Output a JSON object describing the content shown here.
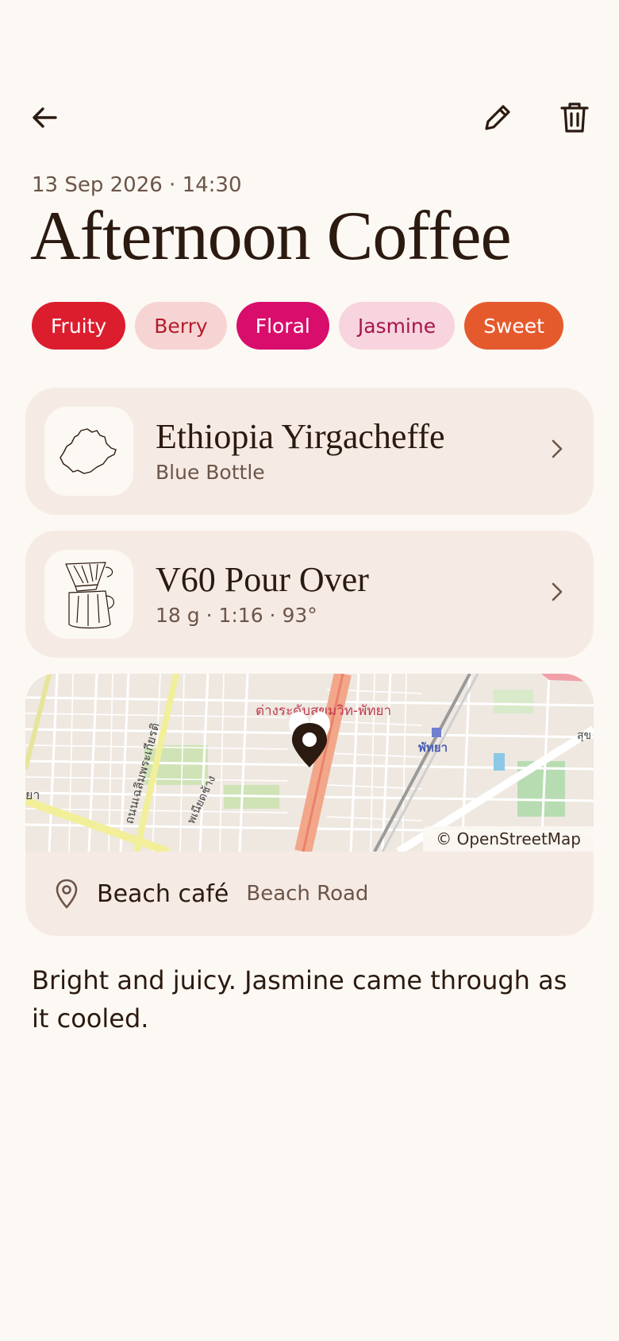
{
  "header": {
    "back_icon": "arrow-left-icon",
    "edit_icon": "pencil-icon",
    "delete_icon": "trash-icon"
  },
  "entry": {
    "datetime": "13 Sep 2026 · 14:30",
    "title": "Afternoon Coffee"
  },
  "tags": [
    {
      "label": "Fruity",
      "bg": "#dc1d2e",
      "fg": "#ffffff"
    },
    {
      "label": "Berry",
      "bg": "#f6d4d4",
      "fg": "#b31c2a"
    },
    {
      "label": "Floral",
      "bg": "#d80d6c",
      "fg": "#ffffff"
    },
    {
      "label": "Jasmine",
      "bg": "#f7d4de",
      "fg": "#a5164e"
    },
    {
      "label": "Sweet",
      "bg": "#e55a2d",
      "fg": "#ffffff"
    }
  ],
  "bean": {
    "name": "Ethiopia Yirgacheffe",
    "roaster": "Blue Bottle",
    "icon": "ethiopia-map-icon"
  },
  "brew": {
    "method": "V60 Pour Over",
    "details": "18 g · 1:16 · 93°",
    "icon": "v60-dripper-icon"
  },
  "map": {
    "attribution": "© OpenStreetMap",
    "label_road": "ถนนเฉลิมพระเกียรติ",
    "label_soi": "ต่างระดับสุขุมวิท-พัทยา",
    "label_pattaya": "พัทยา",
    "label_left": "ยา",
    "label_mid": "พเนียดช้าง",
    "label_small": "สุข"
  },
  "place": {
    "name": "Beach café",
    "road": "Beach Road",
    "icon": "location-pin-icon"
  },
  "notes": "Bright and juicy. Jasmine came through as it cooled.",
  "colors": {
    "background": "#fcf8f3",
    "card": "#f6ebe4",
    "text": "#2b1a10",
    "muted": "#6b5549"
  }
}
